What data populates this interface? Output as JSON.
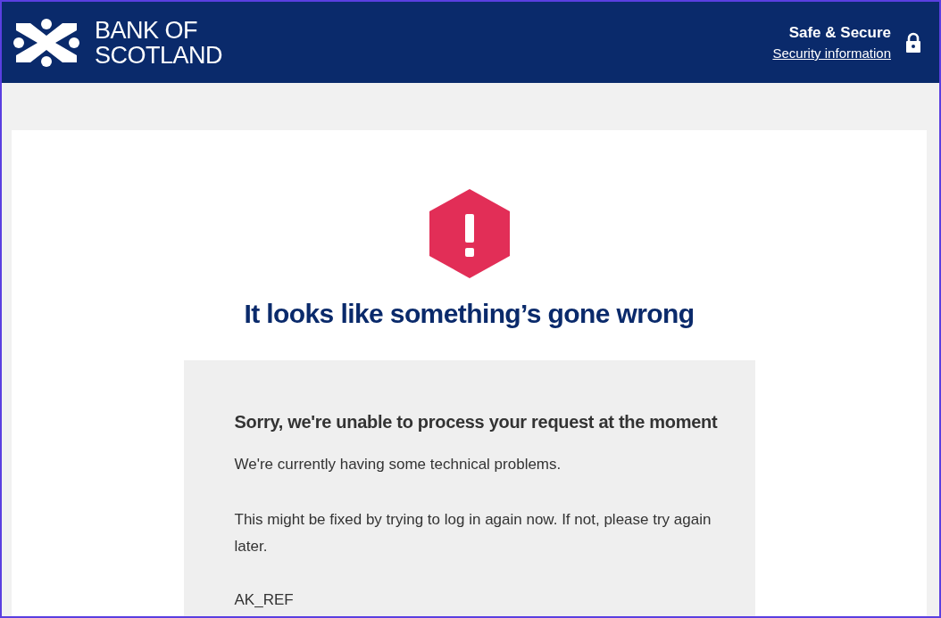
{
  "header": {
    "logo_lines": [
      "BANK OF",
      "SCOTLAND"
    ],
    "security_title": "Safe & Secure",
    "security_link": "Security information"
  },
  "error": {
    "title": "It looks like something’s gone wrong",
    "panel": {
      "heading": "Sorry, we're unable to process your request at the moment",
      "paragraphs": [
        "We're currently having some technical problems.",
        "This might be fixed by trying to log in again now. If not, please try again later."
      ],
      "reference": "AK_REF"
    }
  }
}
